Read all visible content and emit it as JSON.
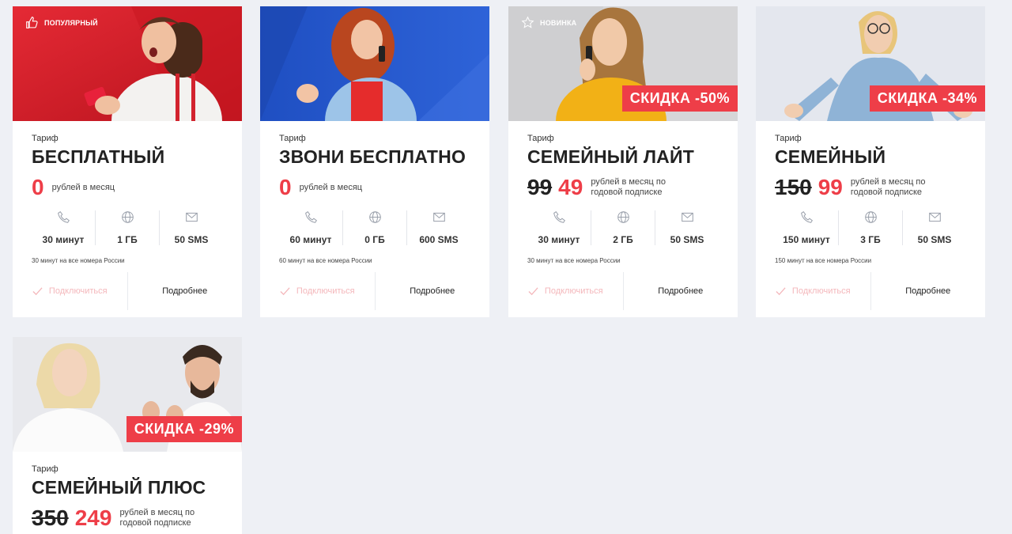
{
  "colors": {
    "accent": "#ee3e48",
    "background": "#eef0f5",
    "connect_text": "#f4b7bb"
  },
  "cards": [
    {
      "badge": {
        "icon": "thumbs-up-icon",
        "text": "популярный"
      },
      "label": "Тариф",
      "name": "БЕСПЛАТНЫЙ",
      "old_price": "",
      "price": "0",
      "price_note": "рублей в месяц",
      "features": [
        {
          "icon": "phone-icon",
          "value": "30 минут"
        },
        {
          "icon": "globe-icon",
          "value": "1 ГБ"
        },
        {
          "icon": "mail-icon",
          "value": "50 SMS"
        }
      ],
      "footnote": "30 минут на все номера России",
      "connect": "Подключиться",
      "more": "Подробнее"
    },
    {
      "label": "Тариф",
      "name": "ЗВОНИ БЕСПЛАТНО",
      "old_price": "",
      "price": "0",
      "price_note": "рублей в месяц",
      "features": [
        {
          "icon": "phone-icon",
          "value": "60 минут"
        },
        {
          "icon": "globe-icon",
          "value": "0 ГБ"
        },
        {
          "icon": "mail-icon",
          "value": "600 SMS"
        }
      ],
      "footnote": "60 минут на все номера России",
      "connect": "Подключиться",
      "more": "Подробнее"
    },
    {
      "badge": {
        "icon": "star-icon",
        "text": "новинка"
      },
      "discount": "СКИДКА -50%",
      "label": "Тариф",
      "name": "СЕМЕЙНЫЙ ЛАЙТ",
      "old_price": "99",
      "price": "49",
      "price_note": "рублей в месяц по годовой подписке",
      "features": [
        {
          "icon": "phone-icon",
          "value": "30 минут"
        },
        {
          "icon": "globe-icon",
          "value": "2 ГБ"
        },
        {
          "icon": "mail-icon",
          "value": "50 SMS"
        }
      ],
      "footnote": "30 минут на все номера России",
      "connect": "Подключиться",
      "more": "Подробнее"
    },
    {
      "discount": "СКИДКА -34%",
      "label": "Тариф",
      "name": "СЕМЕЙНЫЙ",
      "old_price": "150",
      "price": "99",
      "price_note": "рублей в месяц по годовой подписке",
      "features": [
        {
          "icon": "phone-icon",
          "value": "150 минут"
        },
        {
          "icon": "globe-icon",
          "value": "3 ГБ"
        },
        {
          "icon": "mail-icon",
          "value": "50 SMS"
        }
      ],
      "footnote": "150 минут на все номера России",
      "connect": "Подключиться",
      "more": "Подробнее"
    },
    {
      "discount": "СКИДКА -29%",
      "label": "Тариф",
      "name": "СЕМЕЙНЫЙ ПЛЮС",
      "old_price": "350",
      "price": "249",
      "price_note": "рублей в месяц по годовой подписке"
    }
  ]
}
